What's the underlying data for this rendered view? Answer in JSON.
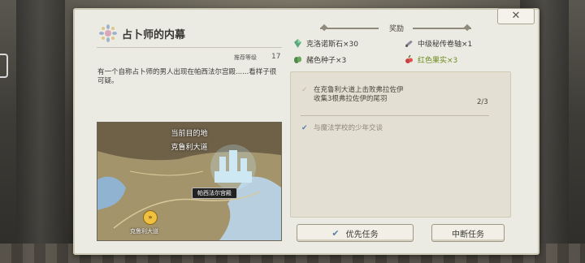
{
  "quest": {
    "title": "占卜师的内幕",
    "recommended_label": "推荐等级",
    "recommended_level": "17",
    "description": "有一个自称占卜师的男人出现在帕西法尔宫殿......看样子很可疑。"
  },
  "map": {
    "current_destination_label": "当前目的地",
    "current_destination": "克鲁利大道",
    "landmark_label": "帕西法尔宫殿",
    "pin_label": "克鲁利大道"
  },
  "rewards": {
    "label": "奖励",
    "items": [
      {
        "name": "克洛诺斯石×30",
        "icon": "crystal-icon",
        "color": "#5aa87c"
      },
      {
        "name": "中级秘传卷轴×1",
        "icon": "scroll-icon",
        "color": "#7a7a8a"
      },
      {
        "name": "赭色种子×3",
        "icon": "seed-icon",
        "color": "#4c8a48"
      },
      {
        "name": "红色果实×3",
        "icon": "fruit-icon",
        "color": "#6a8a1a",
        "highlight": true
      }
    ]
  },
  "tasks": [
    {
      "text_line1": "在克鲁利大道上击败弗拉佐伊",
      "text_line2": "收集3根弗拉佐伊的尾羽",
      "progress": "2/3",
      "state": "pending"
    },
    {
      "text_line1": "与魔法学校的少年交谈",
      "state": "done"
    }
  ],
  "buttons": {
    "priority": "优先任务",
    "abort": "中断任务",
    "close_symbol": "✕"
  },
  "colors": {
    "panel_bg": "#ecebe3",
    "accent_blue": "#5d7ea8",
    "highlight_green": "#6a8a1a"
  }
}
